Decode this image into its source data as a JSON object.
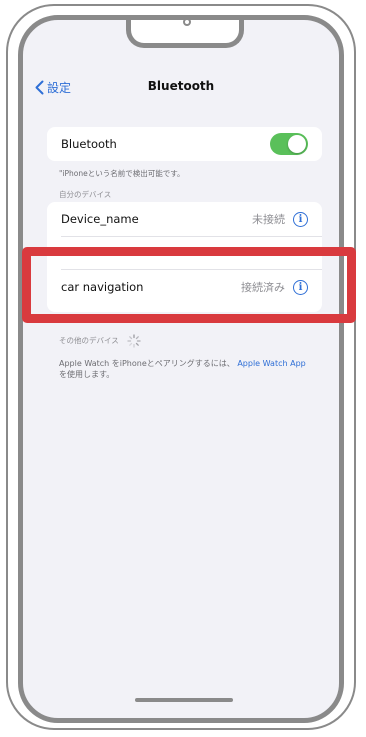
{
  "nav": {
    "back_label": "設定",
    "title": "Bluetooth"
  },
  "bluetooth_card": {
    "label": "Bluetooth",
    "toggle_on": true,
    "toggle_color": "#5ac05a"
  },
  "discoverable_note": "\"iPhoneという名前で検出可能です。",
  "my_devices": {
    "header": "自分のデバイス",
    "devices": [
      {
        "name": "Device_name",
        "status": "未接続"
      },
      {
        "name": "car navigation",
        "status": "接続済み"
      }
    ]
  },
  "other_devices": {
    "header": "その他のデバイス"
  },
  "footer": {
    "text": "Apple Watch をiPhoneとペアリングするには、",
    "link": "Apple Watch App",
    "text_after": "を使用します。"
  },
  "colors": {
    "accent": "#2f6fd6",
    "highlight": "#d93a3e",
    "background": "#f2f2f7"
  }
}
